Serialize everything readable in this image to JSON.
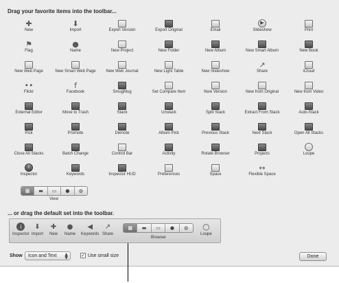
{
  "sheet": {
    "title": "Drag your favorite items into the toolbar...",
    "items": [
      {
        "label": "New",
        "icon": "plus-icon",
        "glyph": "✚",
        "style": "dark"
      },
      {
        "label": "Import",
        "icon": "import-arrow-icon",
        "glyph": "⬇",
        "style": "dark"
      },
      {
        "label": "Export Version",
        "icon": "export-version-icon",
        "glyph": "",
        "style": "box"
      },
      {
        "label": "Export Original",
        "icon": "export-original-icon",
        "glyph": "",
        "style": "dark"
      },
      {
        "label": "Email",
        "icon": "email-stamp-icon",
        "glyph": "",
        "style": "box"
      },
      {
        "label": "Slideshow",
        "icon": "slideshow-play-icon",
        "glyph": "▶",
        "style": "round"
      },
      {
        "label": "Print",
        "icon": "printer-icon",
        "glyph": "",
        "style": "box"
      },
      {
        "label": "Flag",
        "icon": "flag-icon",
        "glyph": "⚑",
        "style": "dark"
      },
      {
        "label": "Name",
        "icon": "person-icon",
        "glyph": "●",
        "style": "dark"
      },
      {
        "label": "New Project",
        "icon": "new-project-icon",
        "glyph": "",
        "style": "box"
      },
      {
        "label": "New Folder",
        "icon": "new-folder-icon",
        "glyph": "",
        "style": "dark"
      },
      {
        "label": "New Album",
        "icon": "new-album-icon",
        "glyph": "",
        "style": "dark"
      },
      {
        "label": "New Smart Album",
        "icon": "new-smart-album-icon",
        "glyph": "",
        "style": "dark"
      },
      {
        "label": "New Book",
        "icon": "new-book-icon",
        "glyph": "",
        "style": "dark"
      },
      {
        "label": "New Web Page",
        "icon": "new-web-page-icon",
        "glyph": "",
        "style": "box"
      },
      {
        "label": "New Smart Web Page",
        "icon": "new-smart-web-page-icon",
        "glyph": "",
        "style": "box"
      },
      {
        "label": "New Web Journal",
        "icon": "new-web-journal-icon",
        "glyph": "",
        "style": "box"
      },
      {
        "label": "New Light Table",
        "icon": "new-light-table-icon",
        "glyph": "",
        "style": "box"
      },
      {
        "label": "New Slideshow",
        "icon": "new-slideshow-icon",
        "glyph": "",
        "style": "box"
      },
      {
        "label": "Share",
        "icon": "share-icon",
        "glyph": "↗",
        "style": "plain"
      },
      {
        "label": "iCloud",
        "icon": "icloud-icon",
        "glyph": "",
        "style": "box"
      },
      {
        "label": "Flickr",
        "icon": "flickr-icon",
        "glyph": "••",
        "style": "plain"
      },
      {
        "label": "Facebook",
        "icon": "facebook-icon",
        "glyph": "f",
        "style": "dark"
      },
      {
        "label": "SmugMug",
        "icon": "smugmug-icon",
        "glyph": "",
        "style": "dark"
      },
      {
        "label": "Set Compare Item",
        "icon": "set-compare-item-icon",
        "glyph": "",
        "style": "box"
      },
      {
        "label": "New Version",
        "icon": "new-version-icon",
        "glyph": "",
        "style": "box"
      },
      {
        "label": "New from Original",
        "icon": "new-from-original-icon",
        "glyph": "",
        "style": "box"
      },
      {
        "label": "New from Video",
        "icon": "new-from-video-icon",
        "glyph": "",
        "style": "box"
      },
      {
        "label": "External Editor",
        "icon": "external-editor-icon",
        "glyph": "",
        "style": "dark"
      },
      {
        "label": "Move to Trash",
        "icon": "trash-icon",
        "glyph": "",
        "style": "dark"
      },
      {
        "label": "Stack",
        "icon": "stack-icon",
        "glyph": "",
        "style": "dark"
      },
      {
        "label": "Unstack",
        "icon": "unstack-icon",
        "glyph": "",
        "style": "dark"
      },
      {
        "label": "Split Stack",
        "icon": "split-stack-icon",
        "glyph": "",
        "style": "dark"
      },
      {
        "label": "Extract From Stack",
        "icon": "extract-from-stack-icon",
        "glyph": "",
        "style": "dark"
      },
      {
        "label": "Auto-Stack",
        "icon": "auto-stack-icon",
        "glyph": "",
        "style": "dark"
      },
      {
        "label": "Pick",
        "icon": "pick-icon",
        "glyph": "",
        "style": "dark"
      },
      {
        "label": "Promote",
        "icon": "promote-icon",
        "glyph": "",
        "style": "dark"
      },
      {
        "label": "Demote",
        "icon": "demote-icon",
        "glyph": "",
        "style": "dark"
      },
      {
        "label": "Album Pick",
        "icon": "album-pick-icon",
        "glyph": "",
        "style": "dark"
      },
      {
        "label": "Previous Stack",
        "icon": "previous-stack-icon",
        "glyph": "",
        "style": "dark"
      },
      {
        "label": "Next Stack",
        "icon": "next-stack-icon",
        "glyph": "",
        "style": "dark"
      },
      {
        "label": "Open All Stacks",
        "icon": "open-all-stacks-icon",
        "glyph": "",
        "style": "dark"
      },
      {
        "label": "Close All Stacks",
        "icon": "close-all-stacks-icon",
        "glyph": "",
        "style": "dark"
      },
      {
        "label": "Batch Change",
        "icon": "batch-change-icon",
        "glyph": "",
        "style": "dark"
      },
      {
        "label": "Control Bar",
        "icon": "control-bar-icon",
        "glyph": "",
        "style": "box"
      },
      {
        "label": "Activity",
        "icon": "activity-icon",
        "glyph": "",
        "style": "dark"
      },
      {
        "label": "Rotate Browser",
        "icon": "rotate-browser-icon",
        "glyph": "",
        "style": "dark"
      },
      {
        "label": "Projects",
        "icon": "projects-icon",
        "glyph": "",
        "style": "dark"
      },
      {
        "label": "Loupe",
        "icon": "loupe-icon",
        "glyph": "",
        "style": "round"
      },
      {
        "label": "Inspector",
        "icon": "inspector-icon",
        "glyph": "i",
        "style": "round-dark"
      },
      {
        "label": "Keywords",
        "icon": "keywords-tag-icon",
        "glyph": "",
        "style": "dark"
      },
      {
        "label": "Inspector HUD",
        "icon": "inspector-hud-icon",
        "glyph": "",
        "style": "dark"
      },
      {
        "label": "Preferences",
        "icon": "preferences-icon",
        "glyph": "",
        "style": "box"
      },
      {
        "label": "Space",
        "icon": "space-box-icon",
        "glyph": "",
        "style": "box"
      },
      {
        "label": "Flexible Space",
        "icon": "flexible-space-icon",
        "glyph": "↔",
        "style": "plain"
      }
    ],
    "view_label": "View",
    "subtitle": "... or drag the default set into the toolbar.",
    "default_set": [
      {
        "label": "Inspector",
        "icon": "inspector-icon",
        "glyph": "i"
      },
      {
        "label": "Import",
        "icon": "import-arrow-icon",
        "glyph": "⬇"
      },
      {
        "label": "New",
        "icon": "plus-icon",
        "glyph": "✚"
      },
      {
        "label": "Name",
        "icon": "person-icon",
        "glyph": "●"
      },
      {
        "label": "Keywords",
        "icon": "keywords-tag-icon",
        "glyph": "◀"
      },
      {
        "label": "Share",
        "icon": "share-icon",
        "glyph": "↗"
      }
    ],
    "browser_label": "Browser",
    "loupe_label": "Loupe",
    "show_label": "Show",
    "show_select_value": "Icon and Text",
    "small_size_label": "Use small size",
    "small_size_checked": "✓",
    "done_label": "Done"
  }
}
